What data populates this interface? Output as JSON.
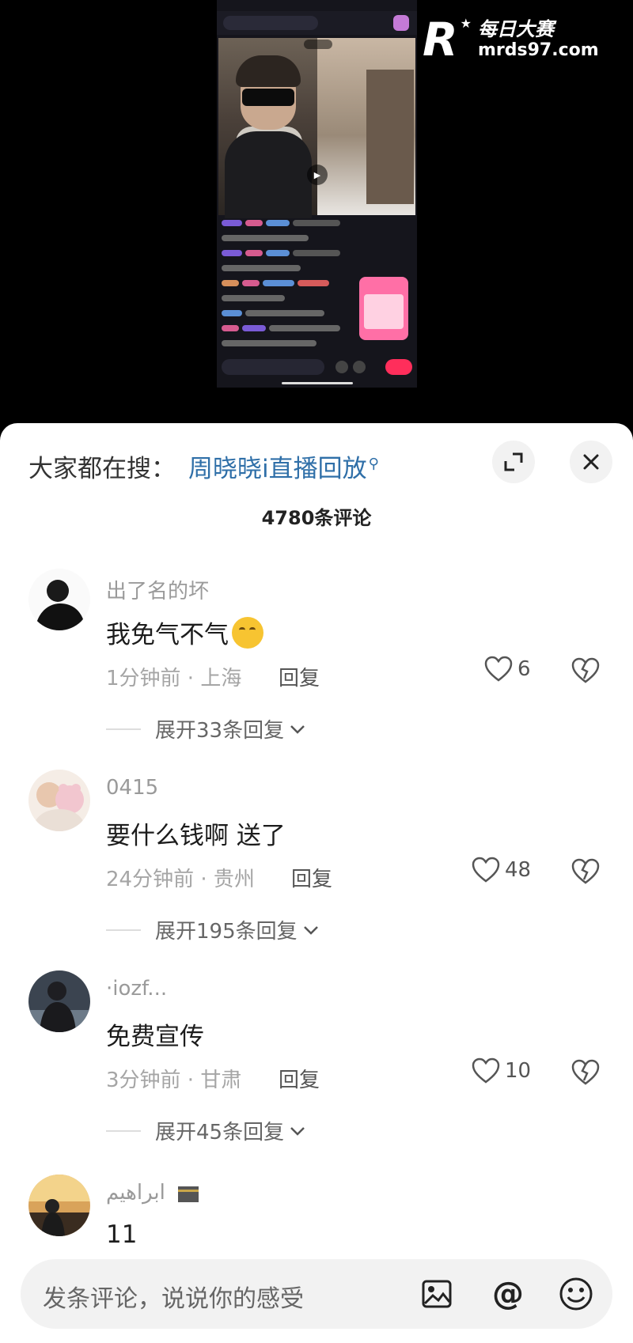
{
  "watermark": {
    "brand_cn": "每日大赛",
    "brand_en": "mrds97.com"
  },
  "sheet": {
    "search_prefix": "大家都在搜：",
    "search_term": "周晓晓i直播回放",
    "search_icon": "search-icon",
    "comment_count": "4780条评论"
  },
  "comments": [
    {
      "username": "出了名的坏",
      "text": "我免气不气",
      "time_location": "1分钟前 · 上海",
      "reply_label": "回复",
      "likes": "6",
      "expand_label": "展开33条回复"
    },
    {
      "username": "0415",
      "text": "要什么钱啊 送了",
      "time_location": "24分钟前 · 贵州",
      "reply_label": "回复",
      "likes": "48",
      "expand_label": "展开195条回复"
    },
    {
      "username": "·iozf...",
      "text": "免费宣传",
      "time_location": "3分钟前 · 甘肃",
      "reply_label": "回复",
      "likes": "10",
      "expand_label": "展开45条回复"
    },
    {
      "username": "ابراهيم",
      "text": "11"
    }
  ],
  "input": {
    "placeholder": "发条评论，说说你的感受",
    "at_label": "@"
  }
}
